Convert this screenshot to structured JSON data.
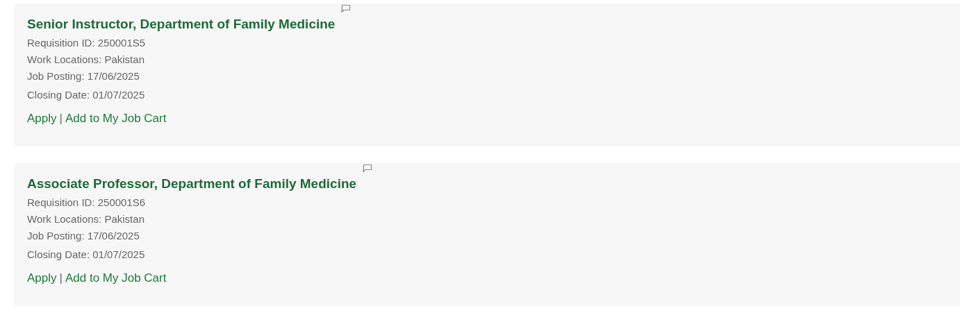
{
  "jobs": [
    {
      "title": "Senior Instructor, Department of Family Medicine",
      "fields": [
        "Requisition ID: 250001S5",
        "Work Locations: Pakistan",
        "Job Posting: 17/06/2025",
        "Closing Date: 01/07/2025"
      ],
      "actions": {
        "apply": "Apply",
        "separator": "|",
        "cart": "Add to My Job Cart"
      }
    },
    {
      "title": "Associate Professor, Department of Family Medicine",
      "fields": [
        "Requisition ID: 250001S6",
        "Work Locations: Pakistan",
        "Job Posting: 17/06/2025",
        "Closing Date: 01/07/2025"
      ],
      "actions": {
        "apply": "Apply",
        "separator": "|",
        "cart": "Add to My Job Cart"
      }
    }
  ]
}
